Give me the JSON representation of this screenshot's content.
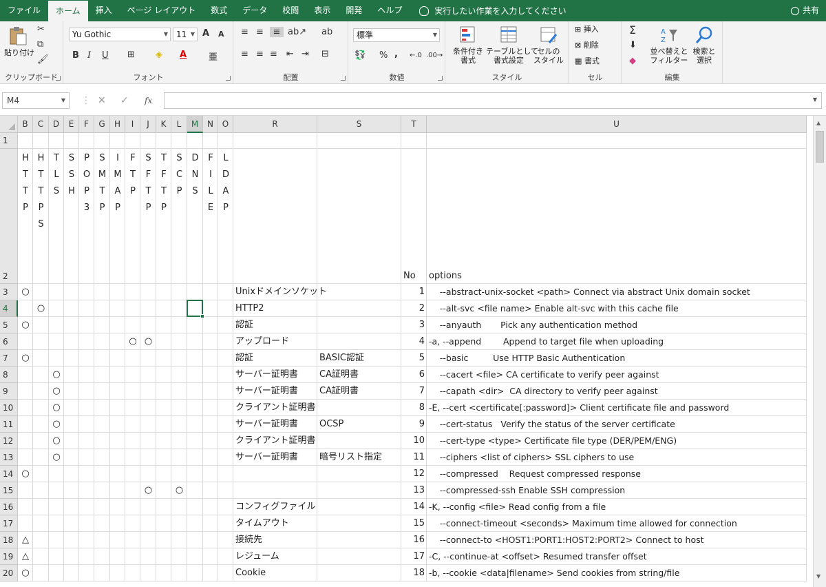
{
  "menu_tabs": [
    "ファイル",
    "ホーム",
    "挿入",
    "ページ レイアウト",
    "数式",
    "データ",
    "校閲",
    "表示",
    "開発",
    "ヘルプ"
  ],
  "tell_me": "実行したい作業を入力してください",
  "share": "共有",
  "ribbon": {
    "clipboard": {
      "label": "クリップボード",
      "paste": "貼り付け"
    },
    "font": {
      "label": "フォント",
      "name": "Yu Gothic",
      "size": "11",
      "grow": "A",
      "shrink": "A",
      "bold": "B",
      "italic": "I",
      "underline": "U"
    },
    "alignment": {
      "label": "配置"
    },
    "number": {
      "label": "数値",
      "format": "標準",
      "percent": "%",
      "comma": ","
    },
    "styles": {
      "label": "スタイル",
      "cond1": "条件付き",
      "cond2": "書式",
      "table1": "テーブルとして",
      "table2": "書式設定",
      "cell1": "セルの",
      "cell2": "スタイル"
    },
    "cells": {
      "label": "セル",
      "insert": "挿入",
      "delete": "削除",
      "format": "書式"
    },
    "editing": {
      "label": "編集",
      "sort1": "並べ替えと",
      "sort2": "フィルター",
      "find1": "検索と",
      "find2": "選択"
    }
  },
  "formula_bar": {
    "name_box": "M4",
    "fx": "fx",
    "value": ""
  },
  "columns": [
    "B",
    "C",
    "D",
    "E",
    "F",
    "G",
    "H",
    "I",
    "J",
    "K",
    "L",
    "M",
    "N",
    "O",
    "R",
    "S",
    "T",
    "U"
  ],
  "protocols": [
    [
      "H",
      "T",
      "T",
      "P"
    ],
    [
      "H",
      "T",
      "T",
      "P",
      "S"
    ],
    [
      "T",
      "L",
      "S"
    ],
    [
      "S",
      "S",
      "H"
    ],
    [
      "P",
      "O",
      "P",
      "3"
    ],
    [
      "S",
      "M",
      "T",
      "P"
    ],
    [
      "I",
      "M",
      "A",
      "P"
    ],
    [
      "F",
      "T",
      "P"
    ],
    [
      "S",
      "F",
      "T",
      "P"
    ],
    [
      "T",
      "F",
      "T",
      "P"
    ],
    [
      "S",
      "C",
      "P"
    ],
    [
      "D",
      "N",
      "S"
    ],
    [
      "F",
      "I",
      "L",
      "E"
    ],
    [
      "L",
      "D",
      "A",
      "P"
    ]
  ],
  "header_row": {
    "no": "No",
    "options": "options"
  },
  "rows": [
    {
      "row": "3",
      "marks": {
        "B": "○"
      },
      "r": "Unixドメインソケット",
      "s": "",
      "no": "1",
      "opt": "    --abstract-unix-socket <path> Connect via abstract Unix domain socket"
    },
    {
      "row": "4",
      "marks": {
        "C": "○"
      },
      "r": "HTTP2",
      "s": "",
      "no": "2",
      "opt": "    --alt-svc <file name> Enable alt-svc with this cache file"
    },
    {
      "row": "5",
      "marks": {
        "B": "○"
      },
      "r": "認証",
      "s": "",
      "no": "3",
      "opt": "    --anyauth       Pick any authentication method"
    },
    {
      "row": "6",
      "marks": {
        "I": "○",
        "J": "○"
      },
      "r": "アップロード",
      "s": "",
      "no": "4",
      "opt": "-a, --append        Append to target file when uploading"
    },
    {
      "row": "7",
      "marks": {
        "B": "○"
      },
      "r": "認証",
      "s": "BASIC認証",
      "no": "5",
      "opt": "    --basic         Use HTTP Basic Authentication"
    },
    {
      "row": "8",
      "marks": {
        "D": "○"
      },
      "r": "サーバー証明書",
      "s": "CA証明書",
      "no": "6",
      "opt": "    --cacert <file> CA certificate to verify peer against"
    },
    {
      "row": "9",
      "marks": {
        "D": "○"
      },
      "r": "サーバー証明書",
      "s": "CA証明書",
      "no": "7",
      "opt": "    --capath <dir>  CA directory to verify peer against"
    },
    {
      "row": "10",
      "marks": {
        "D": "○"
      },
      "r": "クライアント証明書",
      "s": "",
      "no": "8",
      "opt": "-E, --cert <certificate[:password]> Client certificate file and password"
    },
    {
      "row": "11",
      "marks": {
        "D": "○"
      },
      "r": "サーバー証明書",
      "s": "OCSP",
      "no": "9",
      "opt": "    --cert-status   Verify the status of the server certificate"
    },
    {
      "row": "12",
      "marks": {
        "D": "○"
      },
      "r": "クライアント証明書",
      "s": "",
      "no": "10",
      "opt": "    --cert-type <type> Certificate file type (DER/PEM/ENG)"
    },
    {
      "row": "13",
      "marks": {
        "D": "○"
      },
      "r": "サーバー証明書",
      "s": "暗号リスト指定",
      "no": "11",
      "opt": "    --ciphers <list of ciphers> SSL ciphers to use"
    },
    {
      "row": "14",
      "marks": {
        "B": "○"
      },
      "r": "",
      "s": "",
      "no": "12",
      "opt": "    --compressed    Request compressed response"
    },
    {
      "row": "15",
      "marks": {
        "J": "○",
        "L": "○"
      },
      "r": "",
      "s": "",
      "no": "13",
      "opt": "    --compressed-ssh Enable SSH compression"
    },
    {
      "row": "16",
      "marks": {},
      "r": "コンフィグファイル",
      "s": "",
      "no": "14",
      "opt": "-K, --config <file> Read config from a file"
    },
    {
      "row": "17",
      "marks": {},
      "r": "タイムアウト",
      "s": "",
      "no": "15",
      "opt": "    --connect-timeout <seconds> Maximum time allowed for connection"
    },
    {
      "row": "18",
      "marks": {
        "B": "△"
      },
      "r": "接続先",
      "s": "",
      "no": "16",
      "opt": "    --connect-to <HOST1:PORT1:HOST2:PORT2> Connect to host"
    },
    {
      "row": "19",
      "marks": {
        "B": "△"
      },
      "r": "レジューム",
      "s": "",
      "no": "17",
      "opt": "-C, --continue-at <offset> Resumed transfer offset"
    },
    {
      "row": "20",
      "marks": {
        "B": "○"
      },
      "r": "Cookie",
      "s": "",
      "no": "18",
      "opt": "-b, --cookie <data|filename> Send cookies from string/file"
    }
  ],
  "selected": {
    "col": "M",
    "row": "4"
  },
  "colors": {
    "accent": "#217346"
  }
}
